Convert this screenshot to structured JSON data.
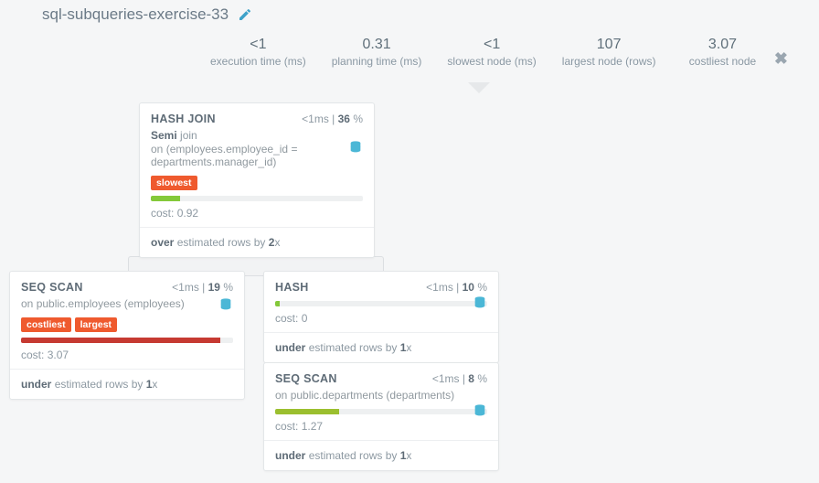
{
  "title": "sql-subqueries-exercise-33",
  "stats": {
    "exec_val": "<1",
    "exec_lbl": "execution time (ms)",
    "plan_val": "0.31",
    "plan_lbl": "planning time (ms)",
    "slow_val": "<1",
    "slow_lbl": "slowest node (ms)",
    "large_val": "107",
    "large_lbl": "largest node (rows)",
    "cost_val": "3.07",
    "cost_lbl": "costliest node"
  },
  "nodes": {
    "n1": {
      "type": "HASH JOIN",
      "time": "<1",
      "time_unit": "ms",
      "pct": "36",
      "semi_a": "Semi",
      "semi_b": "join",
      "on_prefix": "on",
      "on": "(employees.employee_id = departments.manager_id)",
      "tags": [
        "slowest"
      ],
      "bar_pct": 14,
      "bar_class": "green",
      "cost_lbl": "cost:",
      "cost": "0.92",
      "est_a": "over",
      "est_mid": "estimated rows by",
      "est_b": "2",
      "est_x": "x"
    },
    "n2": {
      "type": "SEQ SCAN",
      "time": "<1",
      "time_unit": "ms",
      "pct": "19",
      "on_prefix": "on",
      "on": "public.employees (employees)",
      "tags": [
        "costliest",
        "largest"
      ],
      "bar_pct": 94,
      "bar_class": "red",
      "cost_lbl": "cost:",
      "cost": "3.07",
      "est_a": "under",
      "est_mid": "estimated rows by",
      "est_b": "1",
      "est_x": "x"
    },
    "n3": {
      "type": "HASH",
      "time": "<1",
      "time_unit": "ms",
      "pct": "10",
      "bar_pct": 2,
      "bar_class": "green",
      "cost_lbl": "cost:",
      "cost": "0",
      "est_a": "under",
      "est_mid": "estimated rows by",
      "est_b": "1",
      "est_x": "x"
    },
    "n4": {
      "type": "SEQ SCAN",
      "time": "<1",
      "time_unit": "ms",
      "pct": "8",
      "on_prefix": "on",
      "on": "public.departments (departments)",
      "bar_pct": 30,
      "bar_class": "olive",
      "cost_lbl": "cost:",
      "cost": "1.27",
      "est_a": "under",
      "est_mid": "estimated rows by",
      "est_b": "1",
      "est_x": "x"
    }
  }
}
